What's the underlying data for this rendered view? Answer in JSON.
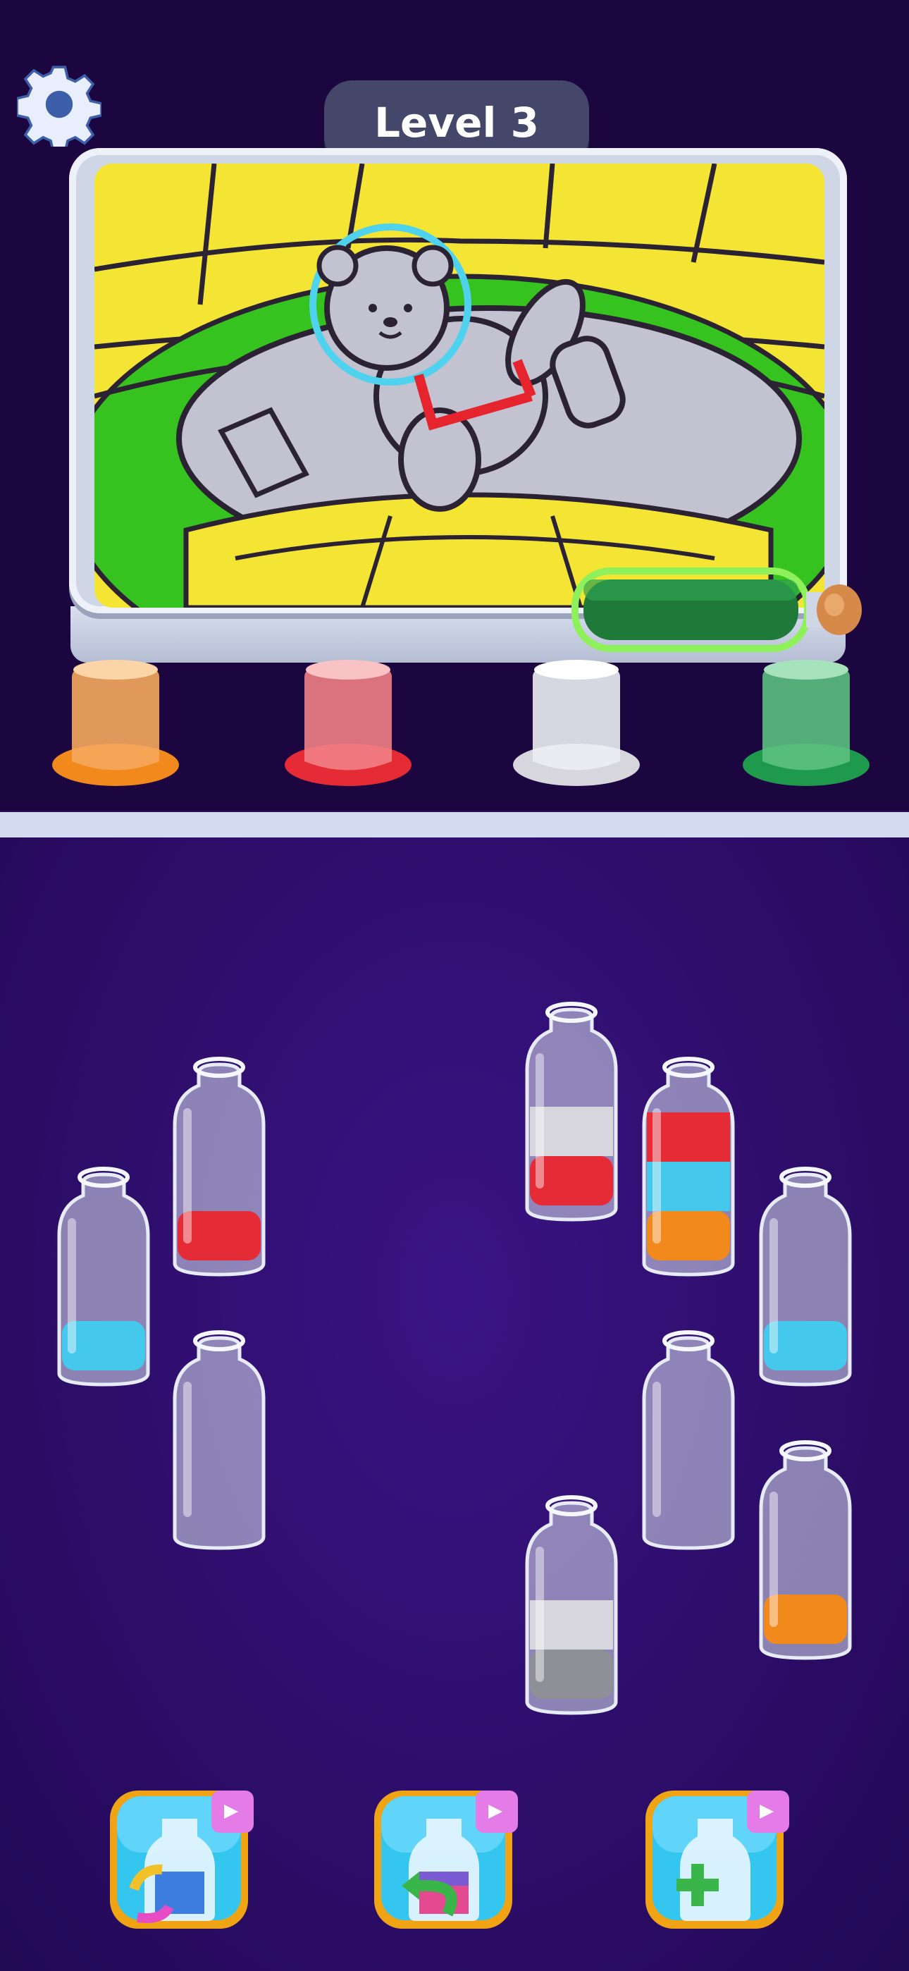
{
  "header": {
    "level_label": "Level 3"
  },
  "icons": {
    "settings": "gear-icon",
    "tools": [
      "shuffle-icon",
      "undo-icon",
      "add-tube-icon"
    ],
    "ad": "video-ad-icon"
  },
  "colors": {
    "orange": "#f2891c",
    "red": "#e52b35",
    "white": "#d6d6dc",
    "green": "#1f9a4c",
    "blue": "#44c8ec",
    "gray": "#8f8f98"
  },
  "color_jars": [
    "orange",
    "red",
    "white",
    "green"
  ],
  "pouring_tube": {
    "color": "green"
  },
  "tubes": [
    {
      "id": "t1",
      "layers": [
        "blue"
      ]
    },
    {
      "id": "t2",
      "layers": [
        "red"
      ]
    },
    {
      "id": "t3",
      "layers": []
    },
    {
      "id": "t4",
      "layers": [
        "red",
        "white"
      ]
    },
    {
      "id": "t5",
      "layers": [
        "orange",
        "blue",
        "red"
      ]
    },
    {
      "id": "t6",
      "layers": [
        "blue"
      ]
    },
    {
      "id": "t7",
      "layers": []
    },
    {
      "id": "t8",
      "layers": [
        "gray",
        "white"
      ]
    },
    {
      "id": "t9",
      "layers": [
        "orange"
      ]
    }
  ]
}
